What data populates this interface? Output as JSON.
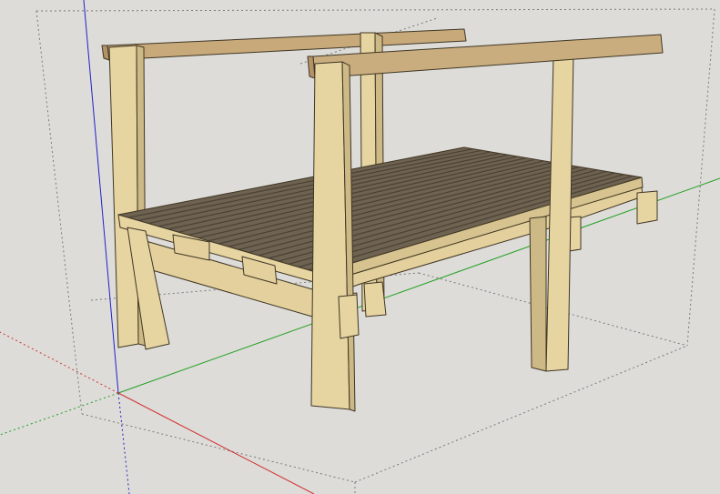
{
  "viewport": {
    "background": "#dddcd9",
    "axis_colors": {
      "red": "#d03030",
      "green": "#20a020",
      "blue": "#2020c8"
    },
    "wood_colors": {
      "face": "#e6d4a1",
      "side": "#c9b47f",
      "edge": "#4a3f28",
      "deck": "#6e6250",
      "deck_dark": "#4b4236",
      "rail": "#c9ad7f"
    }
  },
  "model": {
    "deck_slat_count": 20
  }
}
